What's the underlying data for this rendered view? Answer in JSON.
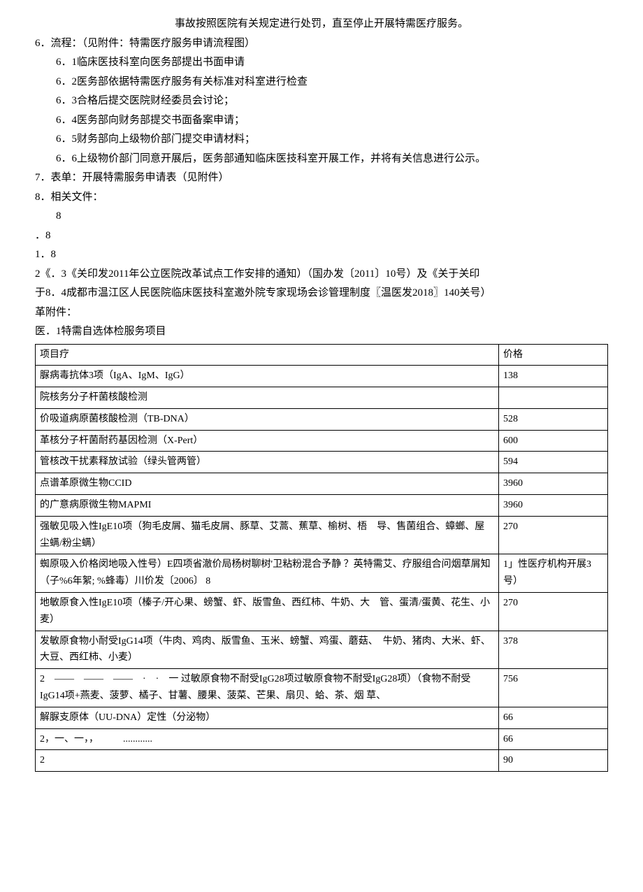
{
  "top_line": "事故按照医院有关规定进行处罚，直至停止开展特需医疗服务。",
  "sec6": {
    "title": "6．流程：（见附件：特需医疗服务申请流程图）",
    "items": [
      "6．1临床医技科室向医务部提出书面申请",
      "6．2医务部依据特需医疗服务有关标准对科室进行检查",
      "6．3合格后提交医院财经委员会讨论；",
      "6．4医务部向财务部提交书面备案申请；",
      "6．5财务部向上级物价部门提交申请材料；",
      "6．6上级物价部门同意开展后，医务部通知临床医技科室开展工作，并将有关信息进行公示。"
    ]
  },
  "sec7": "7．表单：开展特需服务申请表（见附件）",
  "sec8_title": "8．相关文件：",
  "loose_lines": [
    "8",
    "．8",
    "1．8",
    "2《．3《关印发2011年公立医院改革试点工作安排的通知）（国办发〔2011〕10号）及《关于关印",
    "于8．4成都市温江区人民医院临床医技科室邀外院专家现场会诊管理制度〖温医发2018〗140关号）",
    "革附件：",
    "医．1特需自选体检服务项目"
  ],
  "table": {
    "header": {
      "name": "项目疗",
      "price": "价格",
      "note": ""
    },
    "rows": [
      {
        "name": "脲病毒抗体3项（IgA、IgM、IgG）",
        "price": "138",
        "note": ""
      },
      {
        "name": "院核务分子杆菌核酸检测",
        "price": "",
        "note": "",
        "group": true
      },
      {
        "name": "价吸道病原菌核酸检测（TB-DNA）",
        "price": "528",
        "note": ""
      },
      {
        "name": "革核分子杆菌耐药基因检测（X-Pert）",
        "price": "600",
        "note": ""
      },
      {
        "name": "管核改干扰素释放试验（绿头管两管）",
        "price": "594",
        "note": ""
      },
      {
        "name": "点谱革原微生物CCID",
        "price": "3960",
        "note": ""
      },
      {
        "name": "的广意病原微生物MAPMI",
        "price": "3960",
        "note": ""
      },
      {
        "name": "强敏见吸入性IgE10项（狗毛皮屑、猫毛皮屑、豚草、艾蒿、蕉草、榆树、梧　导、售菌组合、蟑螂、屋尘螨/粉尘螨）",
        "price": "270",
        "note": ""
      },
      {
        "name": "蜘原吸入价格闵地吸入性号）E四项省澈价局杨树聊树'卫粘粉混合予静  ？英特需艾、疗服组合问烟草屑知（子%6年絮; %蜂毒）川价发〔2006〕 8",
        "price": "1」性医疗机构开展3号）",
        "note": ""
      },
      {
        "name": "地敏原食入性IgE10项（榛子/开心果、螃蟹、虾、版雪鱼、西红柿、牛奶、大　管、蛋清/蛋黄、花生、小麦）",
        "price": "270",
        "note": ""
      },
      {
        "name": "发敏原食物小耐受IgG14项（牛肉、鸡肉、版雪鱼、玉米、螃蟹、鸡蛋、蘑菇、　牛奶、猪肉、大米、虾、大豆、西红柿、小麦）",
        "price": "378",
        "note": ""
      },
      {
        "name": "2　——　——　——　·　·　一\n过敏原食物不耐受IgG28项过敏原食物不耐受IgG28项）（食物不耐受 IgG14项+燕麦、菠萝、橘子、甘薯、腰果、菠菜、芒果、扇贝、蛤、茶、烟 草、",
        "price": "756",
        "note": ""
      },
      {
        "name": "解脲支原体（UU-DNA）定性（分泌物）",
        "price": "66",
        "note": ""
      },
      {
        "name": "2，一、一，，　　　............",
        "price": "66",
        "note": ""
      },
      {
        "name": "2",
        "price": "90",
        "note": ""
      }
    ]
  }
}
